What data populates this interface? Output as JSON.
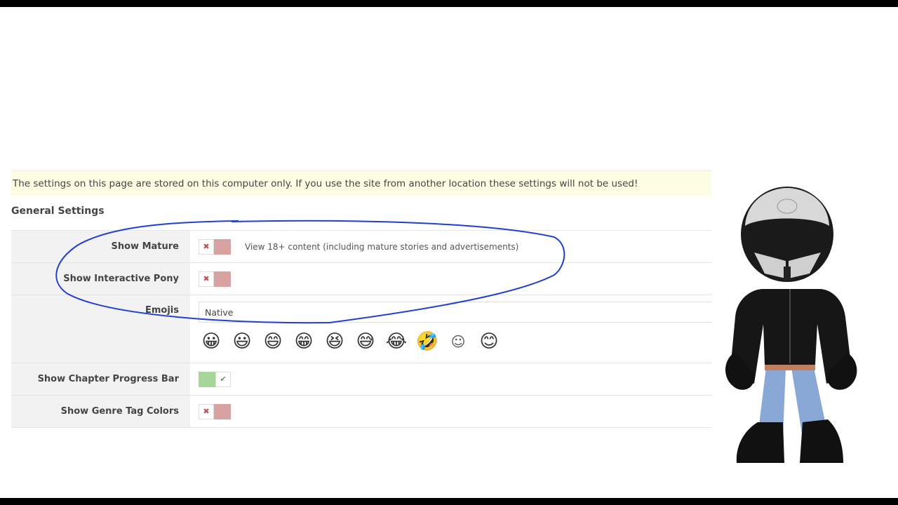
{
  "notice": "The settings on this page are stored on this computer only. If you use the site from another location these settings will not be used!",
  "section_title": "General Settings",
  "settings": {
    "show_mature": {
      "label": "Show Mature",
      "state": "off",
      "description": "View 18+ content (including mature stories and advertisements)"
    },
    "show_pony": {
      "label": "Show Interactive Pony",
      "state": "off"
    },
    "emojis": {
      "label": "Emojis",
      "value": "Native",
      "preview": [
        "😀",
        "😃",
        "😄",
        "😁",
        "😆",
        "😅",
        "😂",
        "🤣",
        "☺",
        "😊"
      ]
    },
    "show_progress": {
      "label": "Show Chapter Progress Bar",
      "state": "on"
    },
    "show_genre_colors": {
      "label": "Show Genre Tag Colors",
      "state": "off"
    }
  },
  "toggle_icons": {
    "off": "✖",
    "on": "✔"
  },
  "colors": {
    "notice_bg": "#fdfde4",
    "toggle_off": "#d9a2a2",
    "toggle_on": "#a8d69a",
    "annotation": "#1f3fd0"
  }
}
